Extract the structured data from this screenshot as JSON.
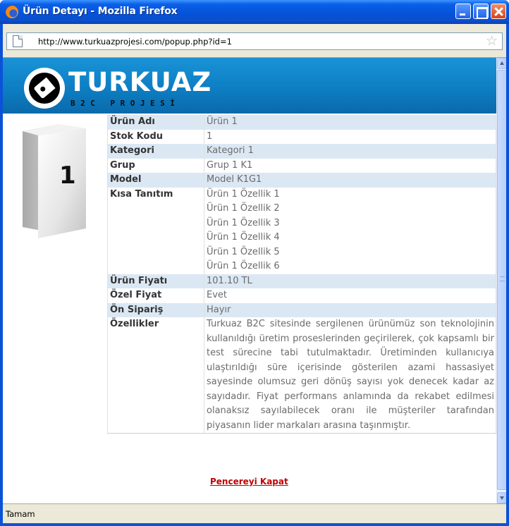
{
  "window": {
    "title": "Ürün Detayı - Mozilla Firefox"
  },
  "addressbar": {
    "url": "http://www.turkuazprojesi.com/popup.php?id=1"
  },
  "banner": {
    "logo_word": "TURKUAZ",
    "logo_sub": "B2C PROJESİ"
  },
  "product": {
    "image_label": "1",
    "rows": [
      {
        "label": "Ürün Adı",
        "value": "Ürün 1"
      },
      {
        "label": "Stok Kodu",
        "value": "1"
      },
      {
        "label": "Kategori",
        "value": "Kategori 1"
      },
      {
        "label": "Grup",
        "value": "Grup 1 K1"
      },
      {
        "label": "Model",
        "value": "Model K1G1"
      }
    ],
    "short_desc": {
      "label": "Kısa Tanıtım",
      "lines": [
        "Ürün 1 Özellik 1",
        "Ürün 1 Özellik 2",
        "Ürün 1 Özellik 3",
        "Ürün 1 Özellik 4",
        "Ürün 1 Özellik 5",
        "Ürün 1 Özellik 6"
      ]
    },
    "rows2": [
      {
        "label": "Ürün Fiyatı",
        "value": "101.10 TL"
      },
      {
        "label": "Özel Fiyat",
        "value": "Evet"
      },
      {
        "label": "Ön Sipariş",
        "value": "Hayır"
      }
    ],
    "features": {
      "label": "Özellikler",
      "text": "Turkuaz B2C sitesinde sergilenen ürünümüz son teknolojinin kullanıldığı üretim proseslerinden geçirilerek, çok kapsamlı bir test sürecine tabi tutulmaktadır. Üretiminden kullanıcıya ulaştırıldığı süre içerisinde gösterilen azami hassasiyet sayesinde olumsuz geri dönüş sayısı yok denecek kadar az sayıdadır. Fiyat performans anlamında da rekabet edilmesi olanaksız sayılabilecek oranı ile müşteriler tarafından piyasanın lider markaları arasına taşınmıştır."
    }
  },
  "close_link": "Pencereyi Kapat",
  "status": "Tamam"
}
